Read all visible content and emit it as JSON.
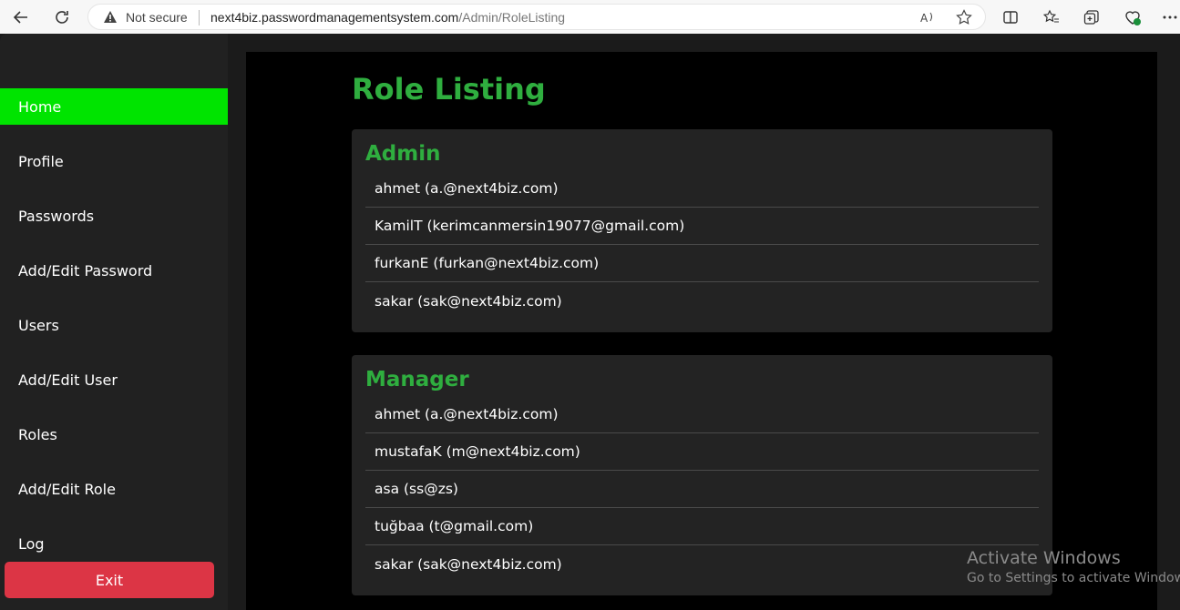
{
  "browser": {
    "security_label": "Not secure",
    "url_host": "next4biz.passwordmanagementsystem.com",
    "url_path": "/Admin/RoleListing"
  },
  "sidebar": {
    "items": [
      {
        "label": "Home",
        "active": true
      },
      {
        "label": "Profile"
      },
      {
        "label": "Passwords"
      },
      {
        "label": "Add/Edit Password"
      },
      {
        "label": "Users"
      },
      {
        "label": "Add/Edit User"
      },
      {
        "label": "Roles"
      },
      {
        "label": "Add/Edit Role"
      },
      {
        "label": "Log"
      }
    ],
    "exit_label": "Exit"
  },
  "main": {
    "title": "Role Listing",
    "roles": [
      {
        "name": "Admin",
        "members": [
          "ahmet (a.@next4biz.com)",
          "KamilT (kerimcanmersin19077@gmail.com)",
          "furkanE (furkan@next4biz.com)",
          "sakar (sak@next4biz.com)"
        ]
      },
      {
        "name": "Manager",
        "members": [
          "ahmet (a.@next4biz.com)",
          "mustafaK (m@next4biz.com)",
          "asa (ss@zs)",
          "tuğbaa (t@gmail.com)",
          "sakar (sak@next4biz.com)"
        ]
      }
    ]
  },
  "watermark": {
    "line1": "Activate Windows",
    "line2": "Go to Settings to activate Windows."
  },
  "colors": {
    "accent_green": "#2fae3f",
    "active_green": "#00e400",
    "exit_red": "#dc3545"
  }
}
